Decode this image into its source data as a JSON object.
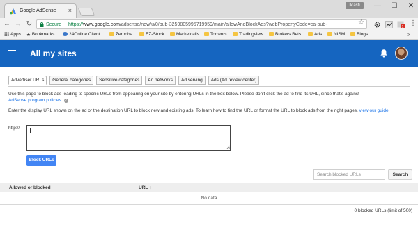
{
  "browser": {
    "tab_title": "Google AdSense",
    "tab_close": "×",
    "profile_badge": "Ikiasti",
    "window_controls": {
      "minimize": "—",
      "maximize": "☐",
      "close": "✕"
    },
    "secure_label": "Secure",
    "url_prefix": "https://",
    "url_host": "www.google.com",
    "url_path": "/adsense/new/u/0/pub-3259805995719959/main/allowAndBlockAds?webPropertyCode=ca-pub-",
    "bookmarks": [
      "Apps",
      "Bookmarks",
      "24Online Client",
      "Zerodha",
      "EZ-Stock",
      "Marketcalls",
      "Torrents",
      "Tradingview",
      "Brokers Bets",
      "Ads",
      "NISM",
      "Blogs"
    ],
    "bookmarks_more": "»",
    "icons": {
      "back": "arrow-left-icon",
      "forward": "arrow-right-icon",
      "reload": "reload-icon",
      "star": "star-icon",
      "menu": "kebab-menu-icon"
    }
  },
  "header": {
    "title": "All my sites",
    "menu_icon": "hamburger-icon",
    "bell_icon": "bell-icon",
    "brand_color": "#1565c0"
  },
  "tabs": [
    {
      "label": "Advertiser URLs",
      "active": true
    },
    {
      "label": "General categories",
      "active": false
    },
    {
      "label": "Sensitive categories",
      "active": false
    },
    {
      "label": "Ad networks",
      "active": false
    },
    {
      "label": "Ad serving",
      "active": false
    },
    {
      "label": "Ads (Ad review center)",
      "active": false
    }
  ],
  "description": {
    "line1": "Use this page to block ads leading to specific URLs from appearing on your site by entering URLs in the box below. Please don't click the ad to find its URL, since that's against",
    "policy_link": "AdSense program policies.",
    "help_icon": "?",
    "line2": "Enter the display URL shown on the ad or the destination URL to block new and existing ads. To learn how to find the URL or format the URL to block ads from the right pages,",
    "view_guide_link": "view our guide",
    "line2_end": "."
  },
  "form": {
    "prefix_label": "http://",
    "textarea_value": "",
    "block_button": "Block URLs"
  },
  "search": {
    "placeholder": "Search blocked URLs",
    "button": "Search"
  },
  "table": {
    "columns": [
      "Allowed or blocked",
      "URL"
    ],
    "sort_indicator": "↑",
    "empty_text": "No data",
    "count_text": "0 blocked URLs (limit of 500)"
  }
}
